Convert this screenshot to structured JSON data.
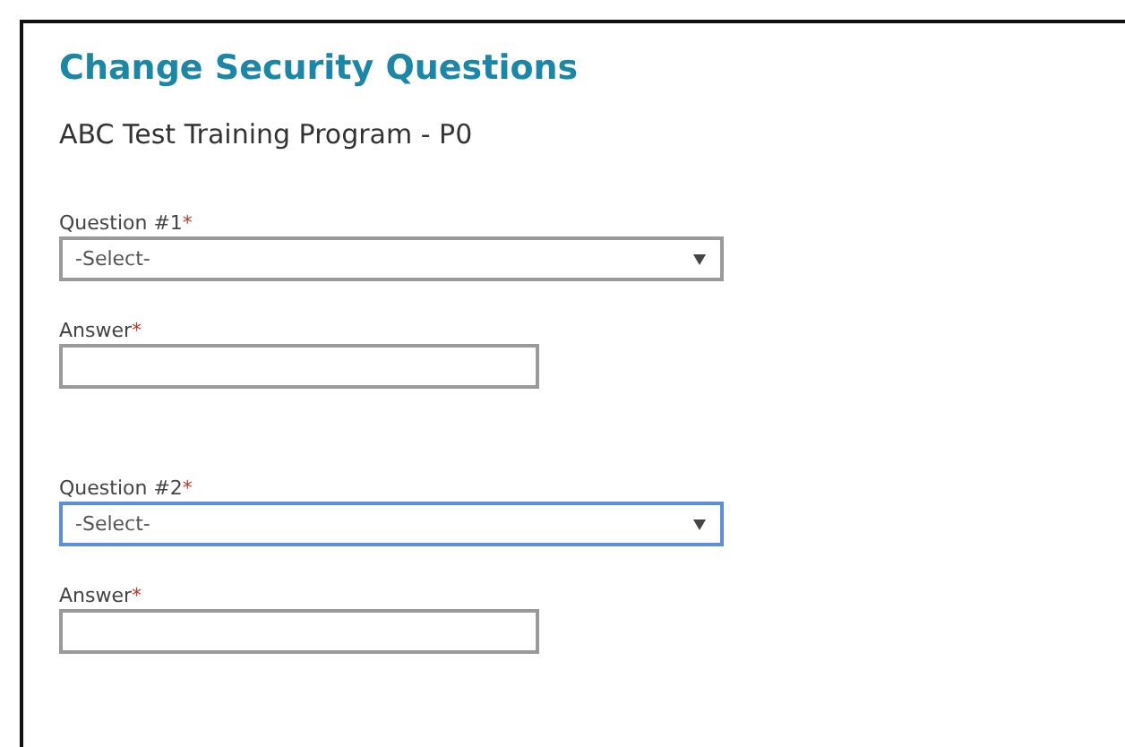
{
  "title": "Change Security Questions",
  "subtitle": "ABC Test Training Program - P0",
  "fields": [
    {
      "kind": "select",
      "label": "Question #1",
      "required_mark": "*",
      "value": "-Select-",
      "focused": false
    },
    {
      "kind": "text",
      "label": "Answer",
      "required_mark": "*",
      "focused": false
    },
    {
      "kind": "select",
      "label": "Question #2",
      "required_mark": "*",
      "value": "-Select-",
      "focused": true
    },
    {
      "kind": "text",
      "label": "Answer",
      "required_mark": "*",
      "focused": false
    }
  ]
}
